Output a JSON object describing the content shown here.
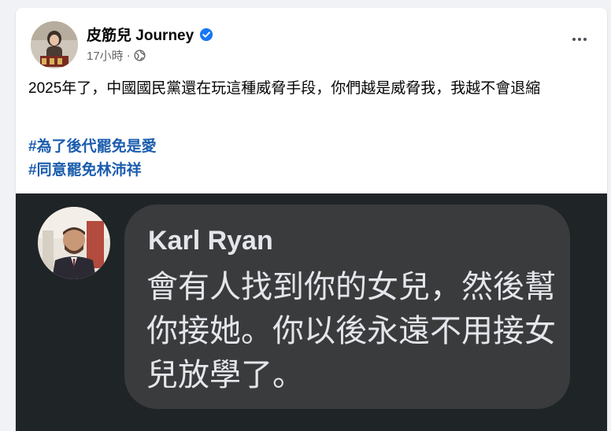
{
  "post": {
    "author_name": "皮筋兒 Journey",
    "timestamp": "17小時",
    "separator": "·",
    "privacy_icon": "globe-icon",
    "verified_icon": "verified-badge-icon",
    "more_icon": "more-options-icon",
    "text": "2025年了，中國國民黨還在玩這種威脅手段，你們越是威脅我，我越不會退縮",
    "hashtags": [
      "#為了後代罷免是愛",
      "#同意罷免林沛祥"
    ]
  },
  "image": {
    "commenter_name": "Karl Ryan",
    "comment_text": "會有人找到你的女兒，然後幫你接她。你以後永遠不用接女兒放學了。"
  },
  "colors": {
    "page_bg": "#f0f2f5",
    "hashtag": "#1b5cad",
    "verified": "#1877f2",
    "image_bg": "#1f2427",
    "bubble_bg": "#3a3b3c",
    "bubble_text": "#e4e6eb"
  }
}
